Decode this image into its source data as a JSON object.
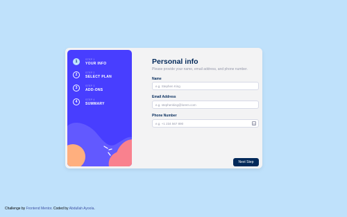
{
  "sidebar": {
    "steps": [
      {
        "number": "1",
        "caption": "STEP 1",
        "title": "YOUR INFO",
        "active": true
      },
      {
        "number": "2",
        "caption": "STEP 2",
        "title": "SELECT PLAN",
        "active": false
      },
      {
        "number": "3",
        "caption": "STEP 3",
        "title": "ADD-ONS",
        "active": false
      },
      {
        "number": "4",
        "caption": "STEP 4",
        "title": "SUMMARY",
        "active": false
      }
    ]
  },
  "form": {
    "title": "Personal info",
    "subtitle": "Please provide your name, email address, and phone number.",
    "name": {
      "label": "Name",
      "placeholder": "e.g. Stephen King",
      "value": ""
    },
    "email": {
      "label": "Email Address",
      "placeholder": "e.g. stephenking@lorem.com",
      "value": ""
    },
    "phone": {
      "label": "Phone Number",
      "placeholder": "e.g. +1 234 567 890",
      "value": "",
      "icon": "contact-card-icon"
    },
    "next_label": "Next Step"
  },
  "attribution": {
    "prefix": "Challenge by",
    "link1": "Frontend Mentor",
    "middle": ". Coded by",
    "link2": "Abdullah Ayoola",
    "suffix": "."
  },
  "colors": {
    "page_bg": "#bfe1fb",
    "sidebar_bg": "#483eff",
    "marine_blue": "#02295a",
    "active_step": "#bfe2fd",
    "card_bg": "#f3f3f4"
  }
}
